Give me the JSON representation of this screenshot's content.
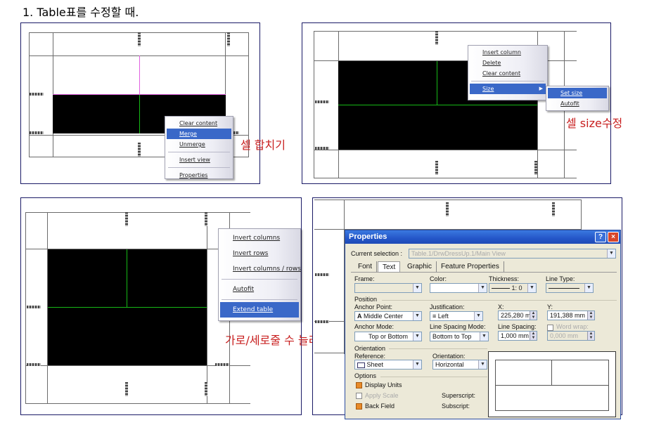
{
  "heading": "1. Table표를 수정할 때.",
  "panel1": {
    "menu": [
      "Clear content",
      "Merge",
      "Unmerge",
      "Insert view",
      "Properties"
    ],
    "selected": "Merge",
    "caption": "셀 합치기"
  },
  "panel2": {
    "menu": [
      "Insert column",
      "Delete",
      "Clear content",
      "Size"
    ],
    "selected": "Size",
    "submenu": [
      "Set size",
      "Autofit"
    ],
    "submenu_selected": "Set size",
    "caption": "셀 size수정"
  },
  "panel3": {
    "menu": [
      "Invert columns",
      "Invert rows",
      "Invert columns / rows",
      "Autofit",
      "Extend table"
    ],
    "selected": "Extend table",
    "caption": "가로/세로줄 수 늘리기"
  },
  "properties": {
    "title": "Properties",
    "help_label": "?",
    "close_label": "×",
    "current_selection_label": "Current selection :",
    "current_selection_value": "Table.1/DrwDressUp.1/Main View",
    "tabs": [
      "Font",
      "Text",
      "Graphic",
      "Feature Properties"
    ],
    "active_tab": "Text",
    "frame_label": "Frame:",
    "color_label": "Color:",
    "thickness_label": "Thickness:",
    "thickness_value": "1: 0",
    "line_type_label": "Line Type:",
    "position_label": "Position",
    "anchor_point_label": "Anchor Point:",
    "anchor_point_value": "Middle Center",
    "anchor_point_glyph": "A",
    "justification_label": "Justification:",
    "justification_value": "Left",
    "x_label": "X:",
    "x_value": "225,280 mm",
    "y_label": "Y:",
    "y_value": "191,388 mm",
    "anchor_mode_label": "Anchor Mode:",
    "anchor_mode_value": "Top or Bottom",
    "line_spacing_mode_label": "Line Spacing Mode:",
    "line_spacing_mode_value": "Bottom to Top",
    "line_spacing_label": "Line Spacing:",
    "line_spacing_value": "1,000 mm",
    "word_wrap_label": "Word wrap:",
    "word_wrap_value": "0,000 mm",
    "orientation_label": "Orientation",
    "reference_label": "Reference:",
    "reference_value": "Sheet",
    "orientation_field_label": "Orientation:",
    "orientation_value": "Horizontal",
    "options_label": "Options",
    "display_units_label": "Display Units",
    "apply_scale_label": "Apply Scale",
    "back_field_label": "Back Field",
    "superscript_label": "Superscript:",
    "subscript_label": "Subscript:"
  },
  "colors": {
    "menu_highlight": "#3a68c8",
    "caption_red": "#c81e1e",
    "green_line": "#16b816",
    "dialog_title": "#2456c8"
  }
}
